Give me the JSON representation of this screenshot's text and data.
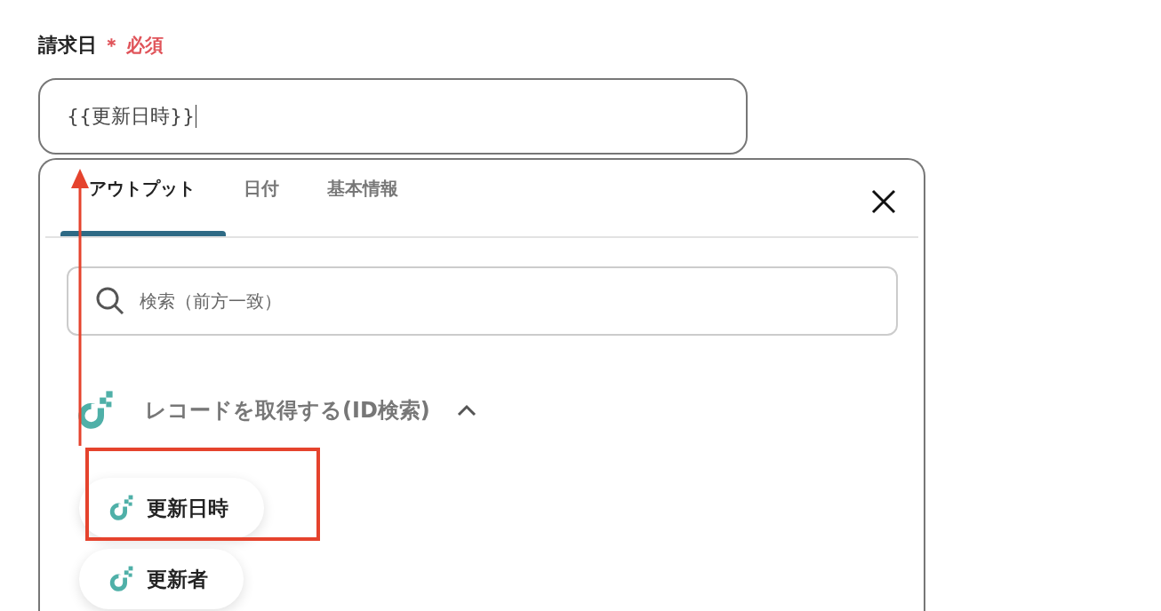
{
  "field": {
    "label": "請求日",
    "required_mark": "＊",
    "required_text": "必須",
    "value": "{{更新日時}}"
  },
  "popup": {
    "tabs": [
      {
        "label": "アウトプット",
        "selected": true
      },
      {
        "label": "日付",
        "selected": false
      },
      {
        "label": "基本情報",
        "selected": false
      }
    ],
    "search": {
      "placeholder": "検索（前方一致）"
    },
    "group": {
      "title": "レコードを取得する(ID検索)",
      "expanded": true,
      "items": [
        {
          "label": "更新日時",
          "highlighted": true
        },
        {
          "label": "更新者",
          "highlighted": false
        }
      ]
    }
  }
}
